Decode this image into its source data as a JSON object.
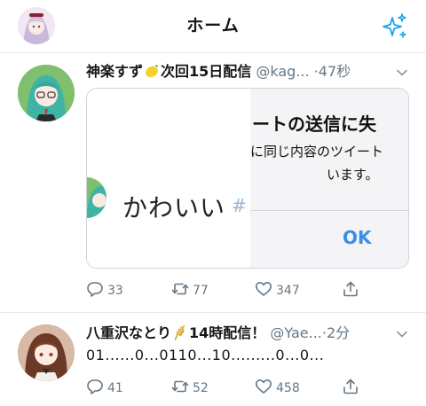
{
  "header": {
    "title": "ホーム"
  },
  "tweets": [
    {
      "name": "神楽すず",
      "name_suffix": "次回15日配信",
      "handle": "@kag...",
      "dot": "·",
      "time": "47秒",
      "replies": "33",
      "retweets": "77",
      "likes": "347",
      "media": {
        "left_text": "かわいい",
        "hash_fragment": "#",
        "dialog_title": "ートの送信に失",
        "dialog_line1": "に同じ内容のツイート",
        "dialog_line2": "います。",
        "dialog_button": "OK"
      },
      "emoji_icon": "lemon-emoji"
    },
    {
      "name": "八重沢なとり",
      "name_suffix": "14時配信！",
      "handle": "@Yae...",
      "dot": "·",
      "time": "2分",
      "text": "01......0...0110...10.........0...0...",
      "replies": "41",
      "retweets": "52",
      "likes": "458",
      "emoji_icon": "rice-emoji"
    }
  ],
  "colors": {
    "accent": "#1da1f2",
    "muted": "#657786",
    "border": "#e6ecf0",
    "ok_blue": "#3a8ee6"
  }
}
